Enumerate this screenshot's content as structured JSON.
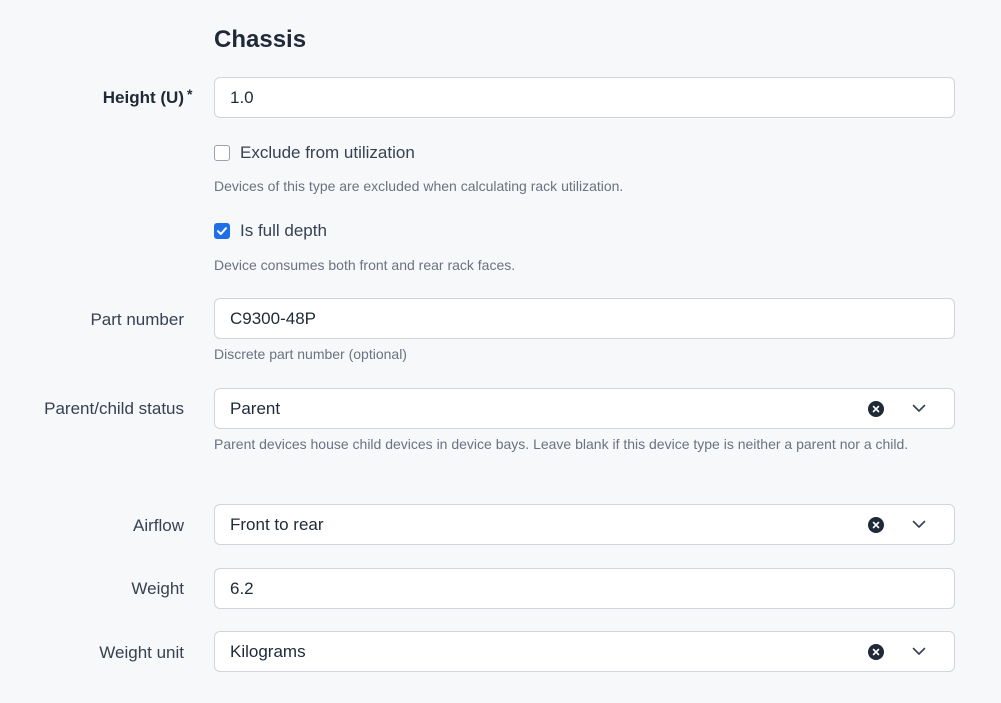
{
  "section": {
    "title": "Chassis"
  },
  "height": {
    "label": "Height (U)",
    "required_mark": "*",
    "value": "1.0"
  },
  "exclude_utilization": {
    "label": "Exclude from utilization",
    "checked": false,
    "help": "Devices of this type are excluded when calculating rack utilization."
  },
  "full_depth": {
    "label": "Is full depth",
    "checked": true,
    "help": "Device consumes both front and rear rack faces."
  },
  "part_number": {
    "label": "Part number",
    "value": "C9300-48P",
    "help": "Discrete part number (optional)"
  },
  "subdevice_role": {
    "label": "Parent/child status",
    "value": "Parent",
    "help": "Parent devices house child devices in device bays. Leave blank if this device type is neither a parent nor a child."
  },
  "airflow": {
    "label": "Airflow",
    "value": "Front to rear"
  },
  "weight": {
    "label": "Weight",
    "value": "6.2"
  },
  "weight_unit": {
    "label": "Weight unit",
    "value": "Kilograms"
  },
  "colors": {
    "accent": "#1f6feb",
    "border": "#d1d5db",
    "background": "#f6f8fa"
  },
  "icons": {
    "clear": "x-circle-icon",
    "dropdown": "chevron-down-icon",
    "check": "check-icon"
  }
}
